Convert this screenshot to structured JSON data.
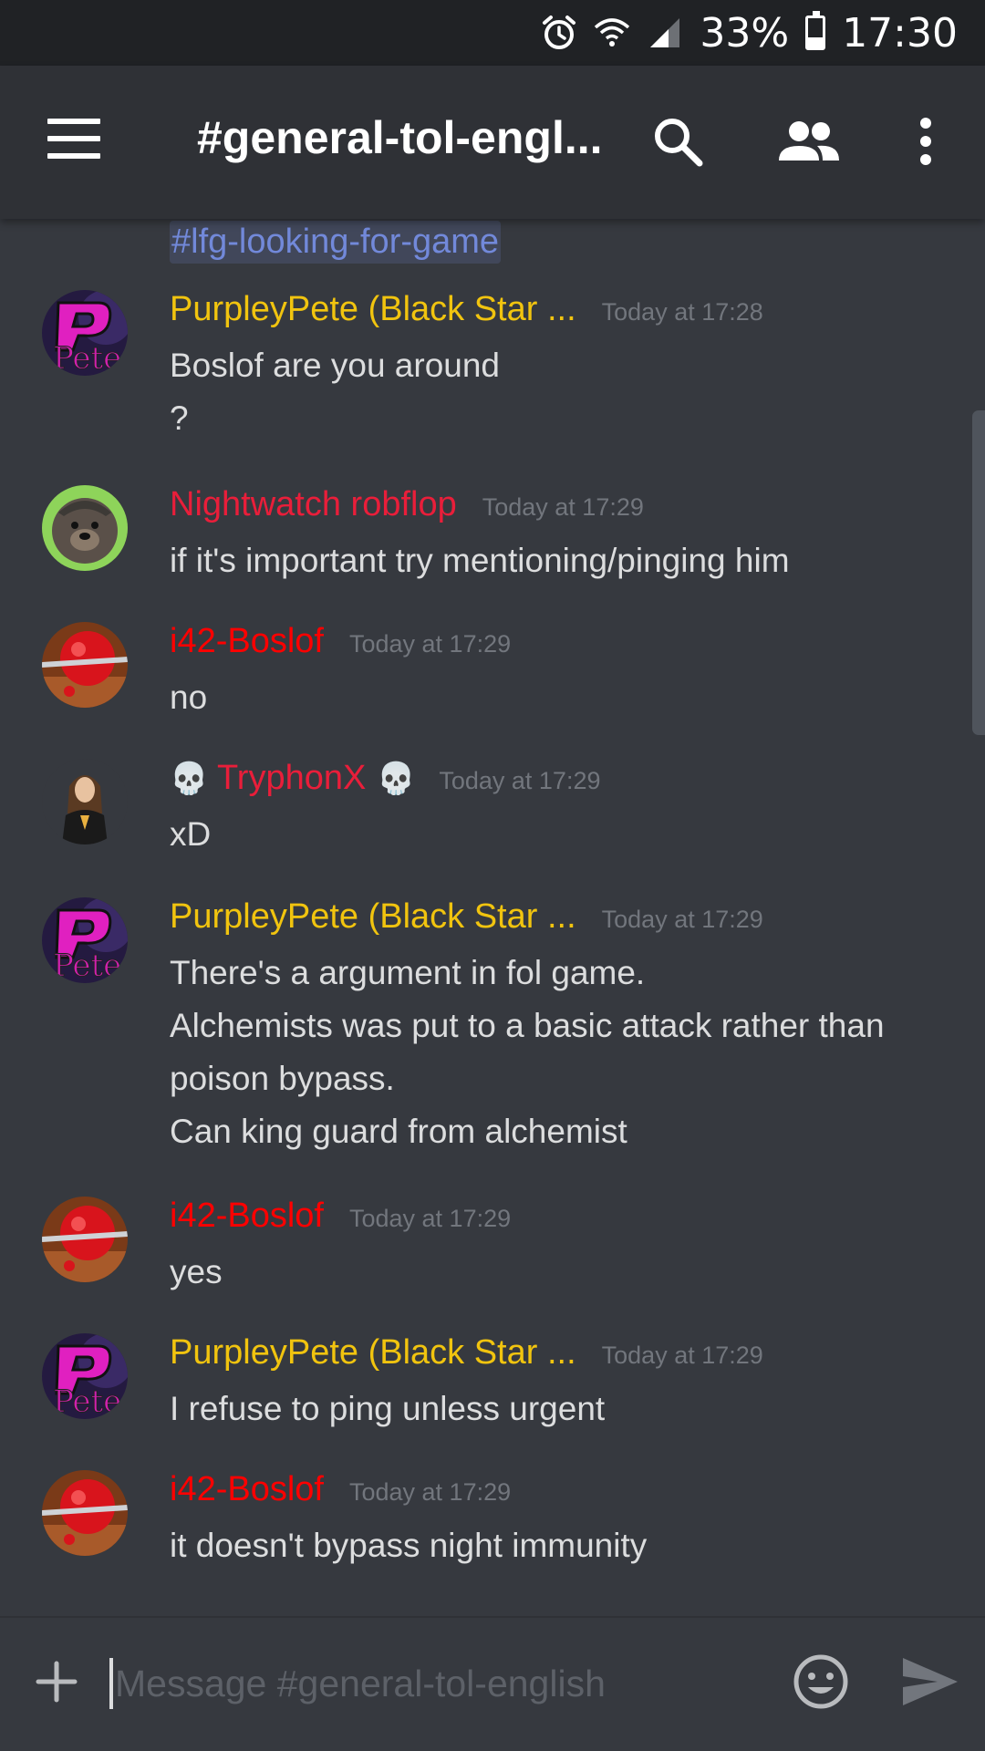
{
  "status_bar": {
    "battery_percent": "33%",
    "battery_level": 0.33,
    "time": "17:30",
    "icons": [
      "alarm-icon",
      "wifi-icon",
      "signal-icon",
      "battery-icon"
    ]
  },
  "header": {
    "channel_title": "#general-tol-engl...",
    "icons": [
      "menu-icon",
      "search-icon",
      "members-icon",
      "more-vertical-icon"
    ]
  },
  "mention": "#lfg-looking-for-game",
  "messages": [
    {
      "author": "PurpleyPete (Black Star ...",
      "color": "#f1c40f",
      "time": "Today at 17:28",
      "lines": [
        "Boslof are you around",
        "?"
      ]
    },
    {
      "author": "Nightwatch robflop",
      "color": "#e91e3a",
      "time": "Today at 17:29",
      "lines": [
        "if it's important try mentioning/pinging him"
      ]
    },
    {
      "author": "i42-Boslof",
      "color": "#ff0000",
      "time": "Today at 17:29",
      "lines": [
        "no"
      ]
    },
    {
      "author": "TryphonX",
      "color": "#e91e3a",
      "time": "Today at 17:29",
      "lines": [
        "xD"
      ],
      "prefix_icon": "skull-icon",
      "suffix_icon": "skull-icon"
    },
    {
      "author": "PurpleyPete (Black Star ...",
      "color": "#f1c40f",
      "time": "Today at 17:29",
      "lines": [
        "There's a argument in fol game.",
        "Alchemists was put to a basic attack rather than",
        "poison bypass.",
        "Can king guard from alchemist"
      ]
    },
    {
      "author": "i42-Boslof",
      "color": "#ff0000",
      "time": "Today at 17:29",
      "lines": [
        "yes"
      ]
    },
    {
      "author": "PurpleyPete (Black Star ...",
      "color": "#f1c40f",
      "time": "Today at 17:29",
      "lines": [
        "I refuse to ping unless urgent"
      ]
    },
    {
      "author": "i42-Boslof",
      "color": "#ff0000",
      "time": "Today at 17:29",
      "lines": [
        "it doesn't bypass night immunity"
      ]
    }
  ],
  "composer": {
    "placeholder": "Message #general-tol-english",
    "icons": [
      "plus-icon",
      "emoji-icon",
      "send-icon"
    ]
  },
  "colors": {
    "background": "#36393f",
    "header": "#2f3136",
    "status_bar": "#202225",
    "link": "#7289da",
    "timestamp": "#72767d"
  }
}
